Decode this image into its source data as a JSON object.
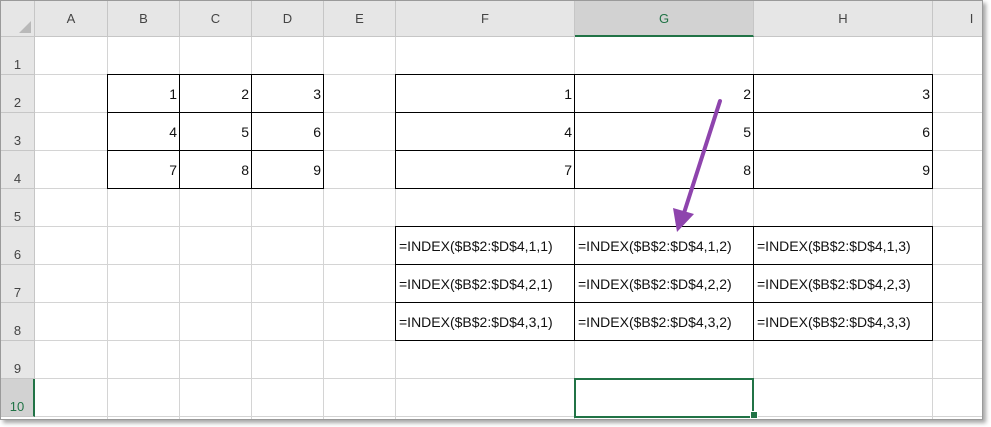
{
  "columns": [
    "A",
    "B",
    "C",
    "D",
    "E",
    "F",
    "G",
    "H",
    "I"
  ],
  "rows": [
    "1",
    "2",
    "3",
    "4",
    "5",
    "6",
    "7",
    "8",
    "9",
    "10"
  ],
  "selected_column": "G",
  "selected_row": "10",
  "source_table": [
    [
      "1",
      "2",
      "3"
    ],
    [
      "4",
      "5",
      "6"
    ],
    [
      "7",
      "8",
      "9"
    ]
  ],
  "result_table": [
    [
      "1",
      "2",
      "3"
    ],
    [
      "4",
      "5",
      "6"
    ],
    [
      "7",
      "8",
      "9"
    ]
  ],
  "formula_table": [
    [
      "=INDEX($B$2:$D$4,1,1)",
      "=INDEX($B$2:$D$4,1,2)",
      "=INDEX($B$2:$D$4,1,3)"
    ],
    [
      "=INDEX($B$2:$D$4,2,1)",
      "=INDEX($B$2:$D$4,2,2)",
      "=INDEX($B$2:$D$4,2,3)"
    ],
    [
      "=INDEX($B$2:$D$4,3,1)",
      "=INDEX($B$2:$D$4,3,2)",
      "=INDEX($B$2:$D$4,3,3)"
    ]
  ],
  "colors": {
    "accent": "#217346",
    "arrow": "#8e44ad",
    "gridline": "#d4d4d4",
    "header_bg": "#e6e6e6"
  }
}
